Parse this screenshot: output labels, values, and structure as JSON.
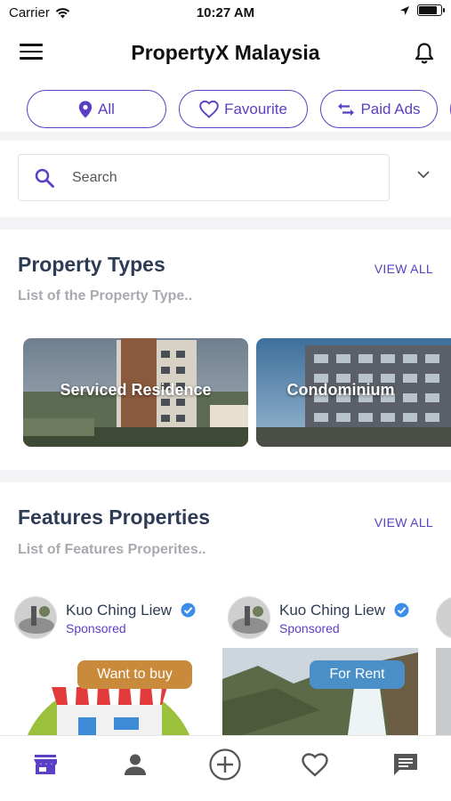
{
  "status_bar": {
    "carrier": "Carrier",
    "time": "10:27 AM",
    "battery_level": 0.9
  },
  "header": {
    "title": "PropertyX Malaysia",
    "menu_icon": "hamburger-menu-icon",
    "notification_icon": "bell-icon"
  },
  "filters": [
    {
      "label": "All",
      "icon": "location-pin-icon"
    },
    {
      "label": "Favourite",
      "icon": "heart-icon"
    },
    {
      "label": "Paid Ads",
      "icon": "swap-arrows-icon"
    }
  ],
  "search": {
    "placeholder": "Search",
    "icon": "search-icon",
    "dropdown_icon": "chevron-down-icon"
  },
  "property_types": {
    "title": "Property Types",
    "subtitle": "List of the Property Type..",
    "view_all": "VIEW ALL",
    "items": [
      {
        "label": "Serviced Residence"
      },
      {
        "label": "Condominium"
      }
    ]
  },
  "featured": {
    "title": "Features Properties",
    "subtitle": "List of Features Properites..",
    "view_all": "VIEW ALL",
    "items": [
      {
        "owner": "Kuo Ching Liew",
        "tag": "Sponsored",
        "badge": "Want to buy",
        "badge_color": "#c98a3c"
      },
      {
        "owner": "Kuo Ching Liew",
        "tag": "Sponsored",
        "badge": "For Rent",
        "badge_color": "#4a8fc7"
      }
    ]
  },
  "tabbar": {
    "items": [
      {
        "icon": "store-icon",
        "active": true
      },
      {
        "icon": "person-icon",
        "active": false
      },
      {
        "icon": "add-circle-icon",
        "active": false
      },
      {
        "icon": "heart-outline-icon",
        "active": false
      },
      {
        "icon": "chat-icon",
        "active": false
      }
    ]
  },
  "colors": {
    "accent": "#5b3fc4",
    "heading": "#2e3b55",
    "verified": "#3b8ee8"
  }
}
